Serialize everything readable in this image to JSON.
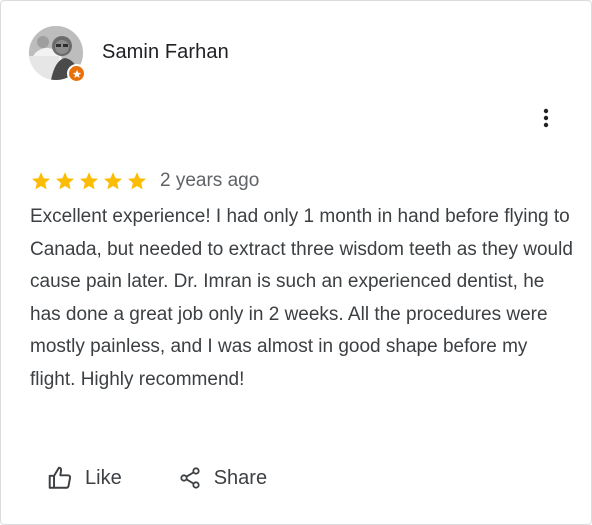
{
  "review": {
    "reviewer_name": "Samin Farhan",
    "rating": 5,
    "max_rating": 5,
    "time_ago": "2 years ago",
    "text": "Excellent experience! I had only 1 month in hand before flying to Canada, but needed to extract three wisdom teeth as they would cause pain later. Dr. Imran is such an experienced dentist, he has done a great job only in 2 weeks. All the procedures were mostly painless, and I was almost in good shape before my flight. Highly recommend!"
  },
  "actions": {
    "like_label": "Like",
    "share_label": "Share"
  },
  "icons": {
    "avatar": "reviewer-photo",
    "badge": "local-guide-star-icon",
    "menu": "more-vert-icon",
    "star": "star-icon",
    "like": "thumb-up-outline-icon",
    "share": "share-icon"
  },
  "colors": {
    "star": "#fbbc04",
    "badge": "#e8710a",
    "text": "#3c4043",
    "muted": "#5f6368"
  }
}
